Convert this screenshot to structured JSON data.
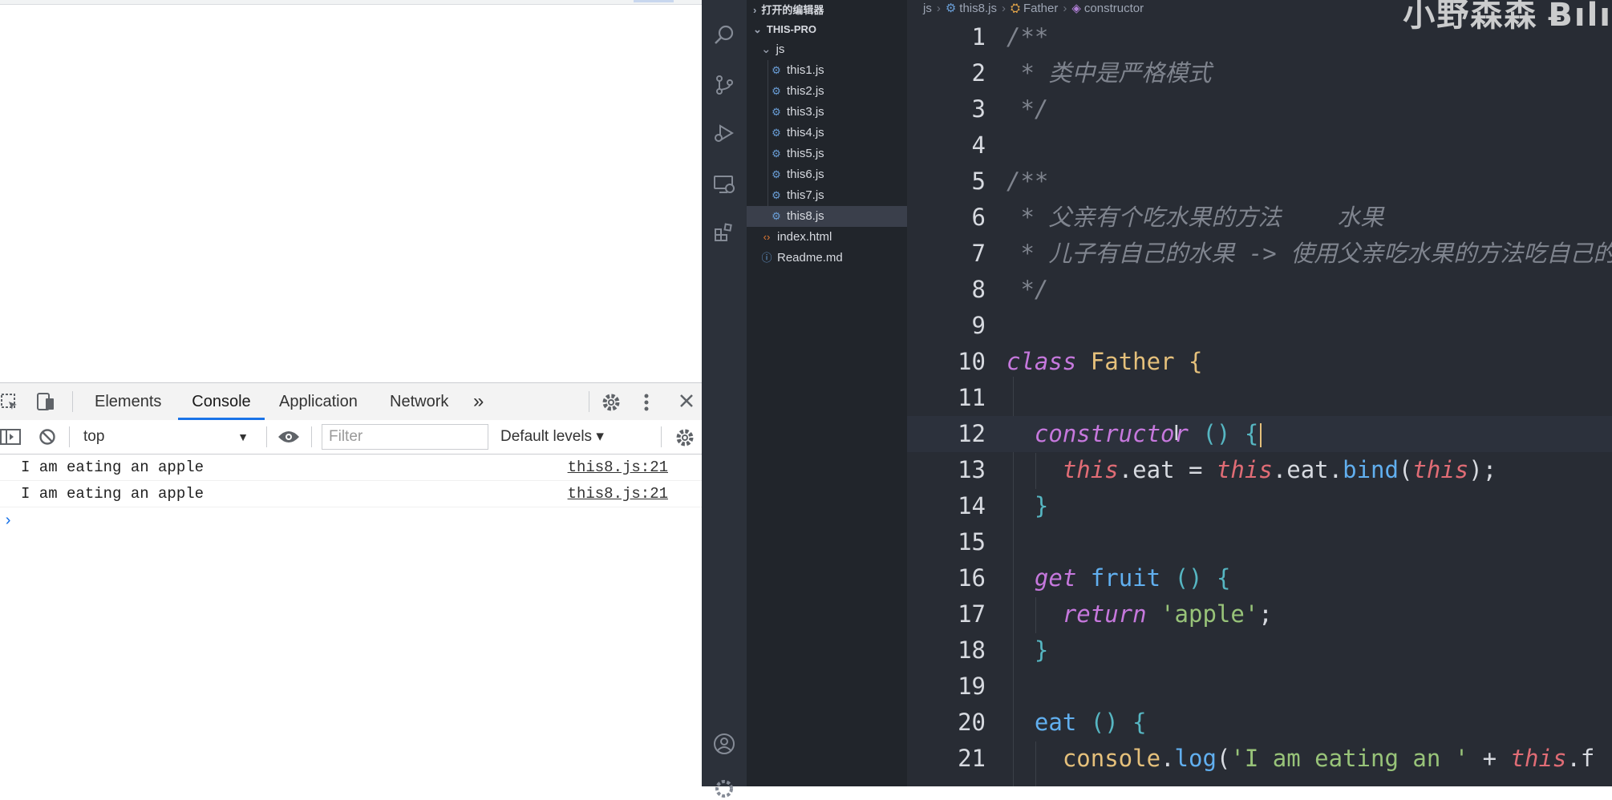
{
  "devtools": {
    "tabs": [
      {
        "label": "Elements"
      },
      {
        "label": "Console"
      },
      {
        "label": "Application"
      },
      {
        "label": "Network"
      }
    ],
    "more_tabs": "»",
    "context": "top",
    "filter_placeholder": "Filter",
    "levels": "Default levels ▾",
    "console": [
      {
        "message": "I am eating an apple",
        "source": "this8.js:21"
      },
      {
        "message": "I am eating an apple",
        "source": "this8.js:21"
      }
    ],
    "prompt": "›"
  },
  "explorer": {
    "open_editors": "打开的编辑器",
    "project": "THIS-PRO",
    "folder": "js",
    "files": [
      "this1.js",
      "this2.js",
      "this3.js",
      "this4.js",
      "this5.js",
      "this6.js",
      "this7.js",
      "this8.js"
    ],
    "root_files": [
      "index.html",
      "Readme.md"
    ]
  },
  "breadcrumb": {
    "items": [
      "js",
      "this8.js",
      "Father",
      "constructor"
    ]
  },
  "watermark": "小野森森",
  "editor": {
    "lines": [
      {
        "n": "1"
      },
      {
        "n": "2"
      },
      {
        "n": "3"
      },
      {
        "n": "4"
      },
      {
        "n": "5"
      },
      {
        "n": "6"
      },
      {
        "n": "7"
      },
      {
        "n": "8"
      },
      {
        "n": "9"
      },
      {
        "n": "10"
      },
      {
        "n": "11"
      },
      {
        "n": "12"
      },
      {
        "n": "13"
      },
      {
        "n": "14"
      },
      {
        "n": "15"
      },
      {
        "n": "16"
      },
      {
        "n": "17"
      },
      {
        "n": "18"
      },
      {
        "n": "19"
      },
      {
        "n": "20"
      },
      {
        "n": "21"
      }
    ],
    "tokens": {
      "l1": "/**",
      "l2": " * 类中是严格模式",
      "l3": " */",
      "l5": "/**",
      "l6": " * 父亲有个吃水果的方法    水果",
      "l7": " * 儿子有自己的水果 -> 使用父亲吃水果的方法吃自己的",
      "l8": " */",
      "class_kw": "class",
      "class_name": "Father",
      "open_brace": "{",
      "constructor": "constructor",
      "parens": "()",
      "this_kw": "this",
      "eat": "eat",
      "bind": "bind",
      "get_kw": "get",
      "fruit": "fruit",
      "return_kw": "return",
      "apple_str": "'apple'",
      "console": "console",
      "log": "log",
      "eating_str": "'I am eating an '",
      "close_brace": "}"
    }
  }
}
